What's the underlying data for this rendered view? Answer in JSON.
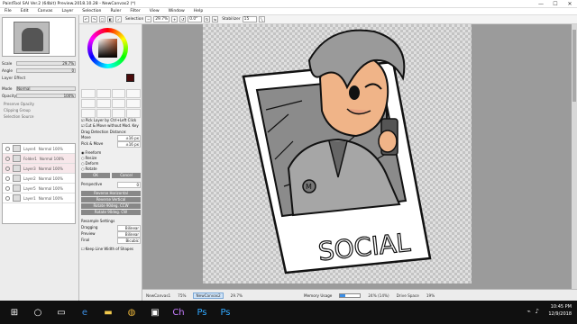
{
  "window": {
    "title": "PaintTool SAI Ver.2 (64bit) Preview.2018.10.28 - NewCanvas2 (*)",
    "minimize": "—",
    "maximize": "☐",
    "close": "✕"
  },
  "menu": [
    "File",
    "Edit",
    "Canvas",
    "Layer",
    "Selection",
    "Ruler",
    "Filter",
    "View",
    "Window",
    "Help"
  ],
  "toolbar": {
    "selection_label": "Selection",
    "zoom": "29.7%",
    "angle": "0.0°",
    "stabilizer_label": "Stabilizer",
    "stabilizer_value": "15"
  },
  "navigator": {
    "scale_label": "Scale",
    "scale_value": "29.7%",
    "angle_label": "Angle",
    "angle_value": "0"
  },
  "layer_panel": {
    "effect_header": "Layer Effect",
    "mode_label": "Mode",
    "mode_value": "Normal",
    "opacity_label": "Opacity",
    "opacity_value": "100%",
    "rows": [
      "Preserve Opacity",
      "Clipping Group",
      "Selection Source"
    ],
    "layers": [
      {
        "name": "Layer4",
        "mode": "Normal 100%"
      },
      {
        "name": "Folder1",
        "mode": "Normal 100%"
      },
      {
        "name": "Layer3",
        "mode": "Normal 100%"
      },
      {
        "name": "Layer2",
        "mode": "Normal 100%"
      },
      {
        "name": "Layer5",
        "mode": "Normal 100%"
      },
      {
        "name": "Layer1",
        "mode": "Normal 100%"
      }
    ]
  },
  "tool_options": {
    "pick_layer": "Pick Layer by Ctrl+Left Click",
    "cut_move": "Cut & Move without Mod. Key",
    "drag_detect": "Drag Detection Distance:",
    "move_label": "Move",
    "move_value": "±16 px",
    "pickmove_label": "Pick & Move",
    "pickmove_value": "±16 px",
    "modes": [
      "Freeform",
      "Resize",
      "Deform",
      "Rotate"
    ],
    "ok": "OK",
    "cancel": "Cancel",
    "perspective_label": "Perspective",
    "perspective_value": "0",
    "reverse_h": "Reverse Horizontal",
    "reverse_v": "Reverse Vertical",
    "rotate_ccw": "Rotate 90deg. CCW",
    "rotate_cw": "Rotate 90deg. CW",
    "resample_label": "Resample Settings",
    "dragging_label": "Dragging",
    "dragging_value": "Bilinear",
    "preview_label": "Preview",
    "preview_value": "Bilinear",
    "final_label": "Final",
    "final_value": "Bicubic",
    "keep_line": "Keep Line Width of Shapes"
  },
  "artwork": {
    "caption": "SOCIAL"
  },
  "docbar": {
    "docs": [
      "NewCanvas1",
      "NewCanvas2"
    ],
    "doc_zoom": [
      "75%",
      "29.7%"
    ],
    "memory_label": "Memory Usage",
    "memory_value": "24% (14%)",
    "memory_fraction": 0.24,
    "drive_label": "Drive Space",
    "drive_value": "19%"
  },
  "taskbar": {
    "time": "10:45 PM",
    "date": "12/9/2018"
  },
  "colors": {
    "skin": "#f0b488",
    "current_color": "#4a0b0b"
  }
}
